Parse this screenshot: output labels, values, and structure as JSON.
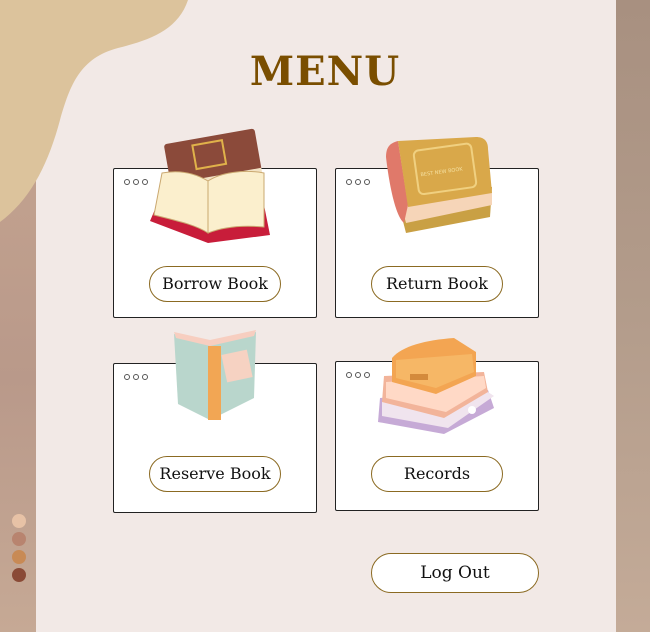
{
  "menu": {
    "title": "MENU"
  },
  "cards": [
    {
      "label": "Borrow Book",
      "icon": "open-book-icon"
    },
    {
      "label": "Return Book",
      "icon": "closed-book-icon"
    },
    {
      "label": "Reserve Book",
      "icon": "standing-book-icon"
    },
    {
      "label": "Records",
      "icon": "book-stack-icon"
    }
  ],
  "logout": {
    "label": "Log Out"
  },
  "book_cover_text": "BEST NEW BOOK",
  "colors": {
    "background": "#f2e9e6",
    "title": "#7a4e00",
    "pill_border": "#8b6a22",
    "blob": "#dcc39c",
    "swatches": [
      "#e7c2a6",
      "#b8846f",
      "#c88a55",
      "#8a4a36"
    ]
  }
}
